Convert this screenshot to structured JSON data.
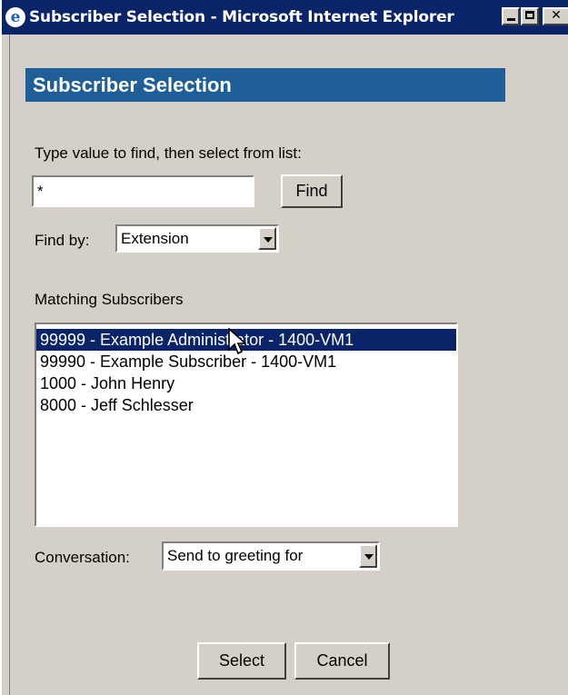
{
  "window": {
    "title": "Subscriber Selection - Microsoft Internet Explorer",
    "ie_icon_glyph": "e",
    "title_bar_color": "#0a246a"
  },
  "window_controls": {
    "minimize_icon": "minimize-icon",
    "maximize_icon": "maximize-icon",
    "close_glyph": "✕"
  },
  "header": {
    "title": "Subscriber Selection",
    "background_color": "#1f5f99"
  },
  "search": {
    "prompt": "Type value to find, then select from list:",
    "value": "*",
    "find_label": "Find"
  },
  "find_by": {
    "label": "Find by:",
    "selected": "Extension"
  },
  "matching": {
    "label": "Matching Subscribers",
    "items": [
      "99999 - Example Administrator - 1400-VM1",
      "99990 - Example Subscriber - 1400-VM1",
      "1000 - John Henry",
      "8000 - Jeff Schlesser"
    ],
    "selected_index": 0,
    "selection_color": "#0a246a"
  },
  "conversation": {
    "label": "Conversation:",
    "selected": "Send to greeting for"
  },
  "actions": {
    "select_label": "Select",
    "cancel_label": "Cancel"
  }
}
